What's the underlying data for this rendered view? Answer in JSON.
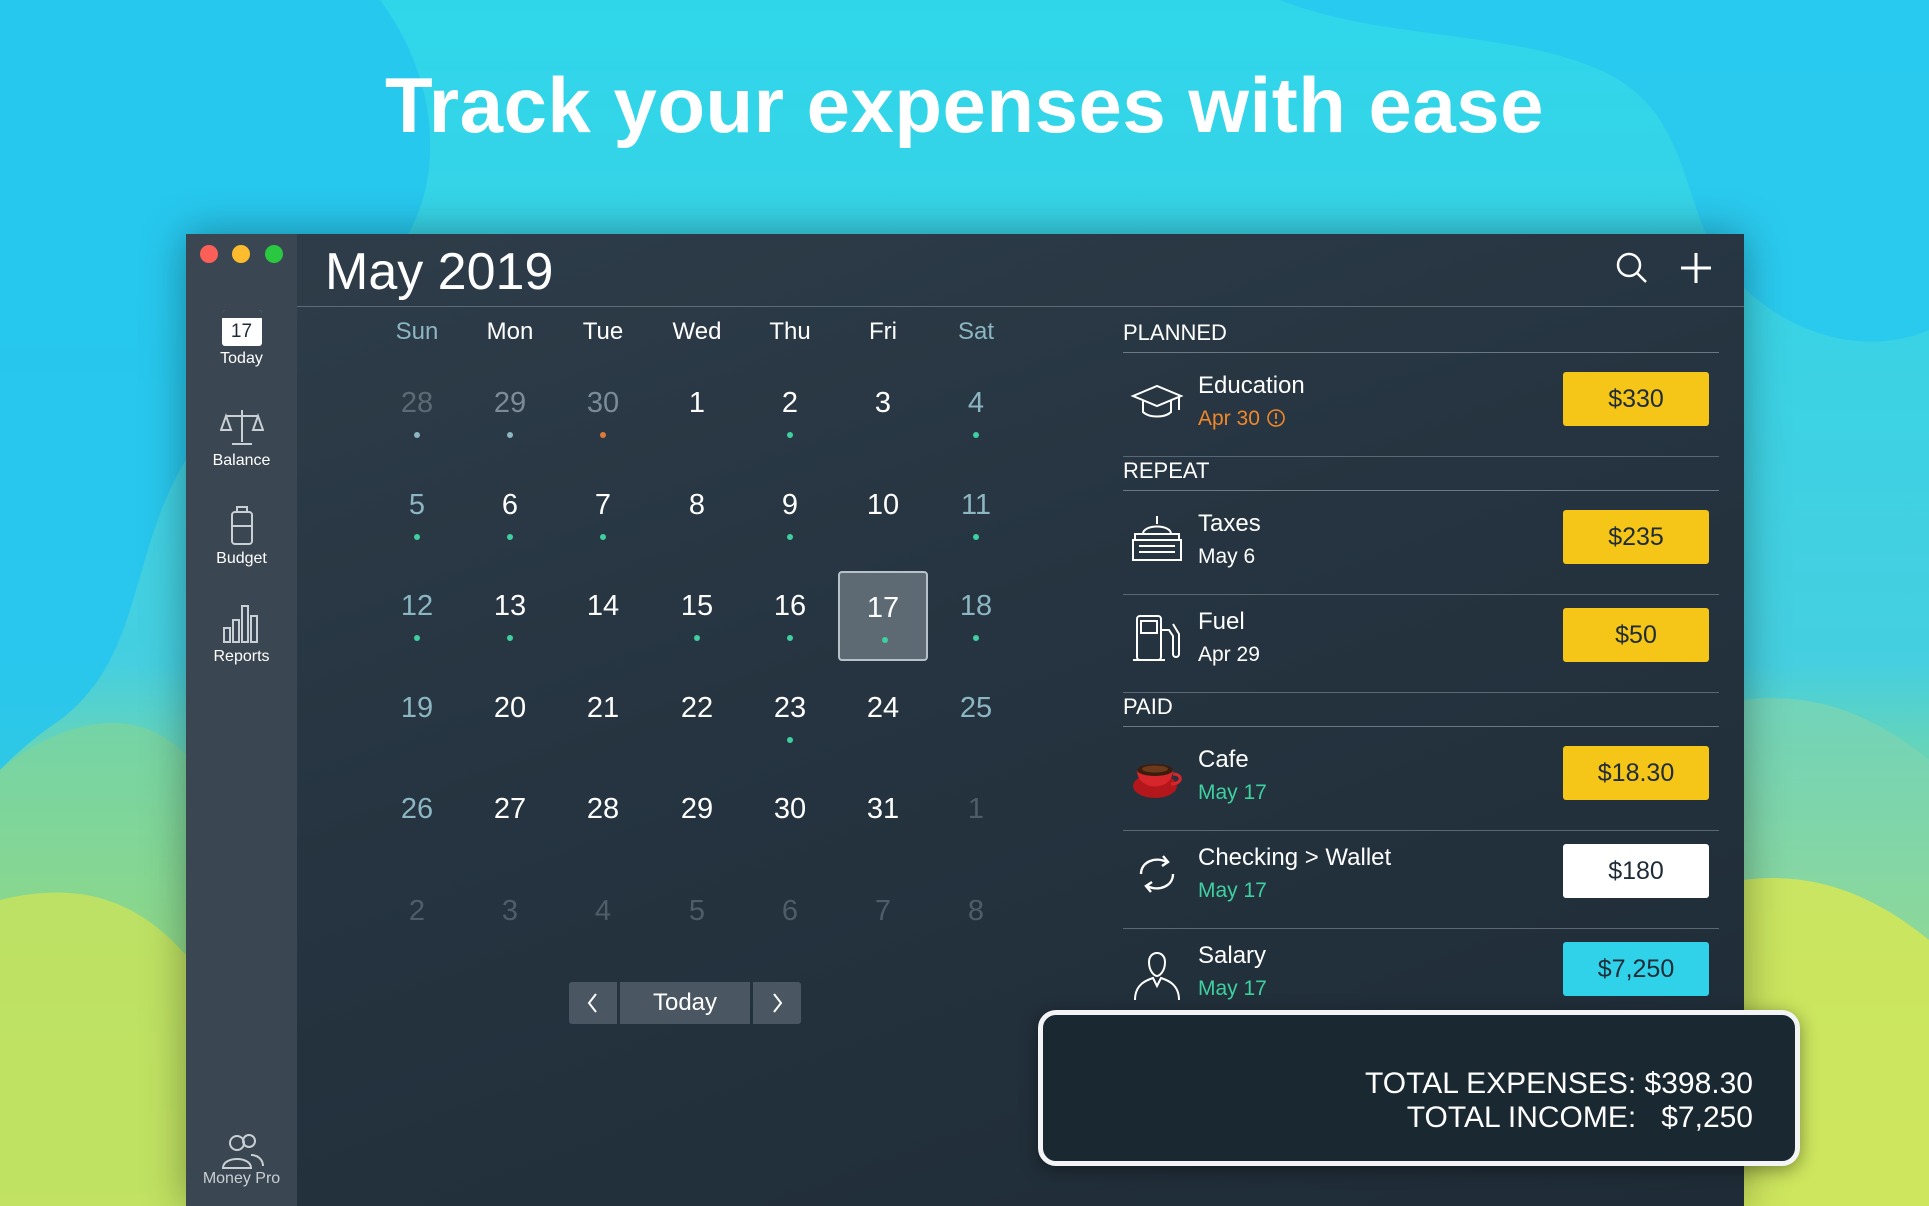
{
  "headline": "Track your expenses with ease",
  "sidebar": {
    "items": [
      {
        "label": "Today",
        "icon": "calendar-icon",
        "day": "17"
      },
      {
        "label": "Balance",
        "icon": "scale-icon"
      },
      {
        "label": "Budget",
        "icon": "budget-icon"
      },
      {
        "label": "Reports",
        "icon": "bar-chart-icon"
      }
    ],
    "footer_label": "Money Pro",
    "footer_icon": "users-icon"
  },
  "header": {
    "month_title": "May 2019",
    "search_icon": "search-icon",
    "add_icon": "plus-icon"
  },
  "calendar": {
    "weekdays": [
      "Sun",
      "Mon",
      "Tue",
      "Wed",
      "Thu",
      "Fri",
      "Sat"
    ],
    "weeks": [
      [
        {
          "d": "28",
          "other": true,
          "dot": "#8bb6c2"
        },
        {
          "d": "29",
          "other": true,
          "dot": "#8bb6c2"
        },
        {
          "d": "30",
          "other": true,
          "dot": "#e07a3a"
        },
        {
          "d": "1"
        },
        {
          "d": "2",
          "dot": "#3fd0a0"
        },
        {
          "d": "3"
        },
        {
          "d": "4",
          "dot": "#3fd0a0"
        }
      ],
      [
        {
          "d": "5",
          "dot": "#3fd0a0"
        },
        {
          "d": "6",
          "dot": "#3fd0a0"
        },
        {
          "d": "7",
          "dot": "#3fd0a0"
        },
        {
          "d": "8"
        },
        {
          "d": "9",
          "dot": "#3fd0a0"
        },
        {
          "d": "10"
        },
        {
          "d": "11",
          "dot": "#3fd0a0"
        }
      ],
      [
        {
          "d": "12",
          "dot": "#3fd0a0"
        },
        {
          "d": "13",
          "dot": "#3fd0a0"
        },
        {
          "d": "14"
        },
        {
          "d": "15",
          "dot": "#3fd0a0"
        },
        {
          "d": "16",
          "dot": "#3fd0a0"
        },
        {
          "d": "17",
          "dot": "#3fd0a0",
          "selected": true
        },
        {
          "d": "18",
          "dot": "#3fd0a0"
        }
      ],
      [
        {
          "d": "19"
        },
        {
          "d": "20"
        },
        {
          "d": "21"
        },
        {
          "d": "22"
        },
        {
          "d": "23",
          "dot": "#3fd0a0"
        },
        {
          "d": "24"
        },
        {
          "d": "25"
        }
      ],
      [
        {
          "d": "26"
        },
        {
          "d": "27"
        },
        {
          "d": "28"
        },
        {
          "d": "29"
        },
        {
          "d": "30"
        },
        {
          "d": "31"
        },
        {
          "d": "1",
          "faint": true
        }
      ],
      [
        {
          "d": "2",
          "faint": true
        },
        {
          "d": "3",
          "faint": true
        },
        {
          "d": "4",
          "faint": true
        },
        {
          "d": "5",
          "faint": true
        },
        {
          "d": "6",
          "faint": true
        },
        {
          "d": "7",
          "faint": true
        },
        {
          "d": "8",
          "faint": true
        }
      ]
    ],
    "today_label": "Today",
    "prev_icon": "chevron-left-icon",
    "next_icon": "chevron-right-icon"
  },
  "sections": [
    {
      "title": "PLANNED",
      "items": [
        {
          "name": "Education",
          "date": "Apr 30",
          "date_color": "#f0882a",
          "warning_icon": "warning-icon",
          "amount": "$330",
          "amount_bg": "#f5c518",
          "icon": "graduation-cap-icon"
        }
      ]
    },
    {
      "title": "REPEAT",
      "items": [
        {
          "name": "Taxes",
          "date": "May 6",
          "date_color": "#ffffff",
          "amount": "$235",
          "amount_bg": "#f5c518",
          "icon": "government-building-icon"
        },
        {
          "name": "Fuel",
          "date": "Apr 29",
          "date_color": "#ffffff",
          "amount": "$50",
          "amount_bg": "#f5c518",
          "icon": "fuel-pump-icon"
        }
      ]
    },
    {
      "title": "PAID",
      "items": [
        {
          "name": "Cafe",
          "date": "May 17",
          "date_color": "#3fd0a0",
          "amount": "$18.30",
          "amount_bg": "#f5c518",
          "icon": "coffee-cup-icon"
        },
        {
          "name": "Checking > Wallet",
          "date": "May 17",
          "date_color": "#3fd0a0",
          "amount": "$180",
          "amount_bg": "#ffffff",
          "icon": "transfer-icon"
        },
        {
          "name": "Salary",
          "date": "May 17",
          "date_color": "#3fd0a0",
          "amount": "$7,250",
          "amount_bg": "#2fd2e8",
          "icon": "person-icon"
        }
      ]
    }
  ],
  "totals": {
    "expenses_label": "TOTAL EXPENSES:",
    "expenses_value": "$398.30",
    "income_label": "TOTAL INCOME:",
    "income_value": "$7,250"
  },
  "colors": {
    "accent_yellow": "#f5c518",
    "accent_cyan": "#2fd2e8",
    "income_green": "#3fd0a0",
    "warning_orange": "#f0882a"
  }
}
